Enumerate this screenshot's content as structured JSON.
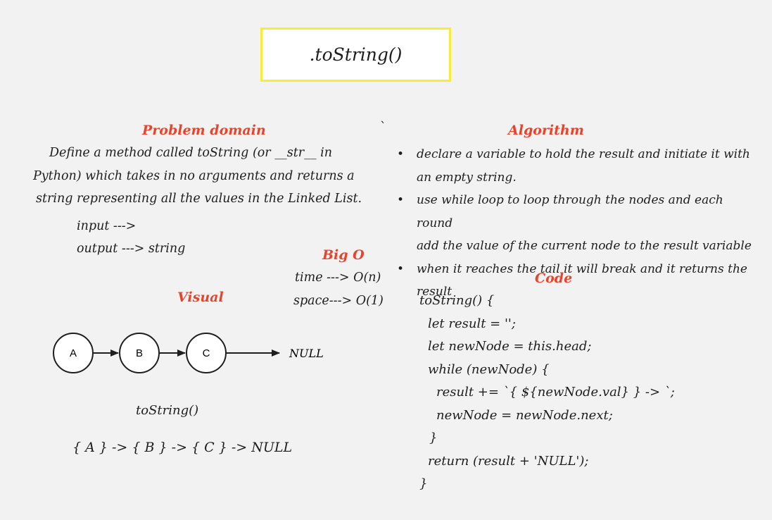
{
  "title": ".toString()",
  "tick_mark": "`",
  "problem_domain": {
    "heading": "Problem domain",
    "lines": [
      "Define a method called toString (or __str__ in",
      "Python) which takes in no arguments and returns a",
      "string representing all the values in the Linked List."
    ],
    "input_line": "input --->",
    "output_line": "output ---> string"
  },
  "big_o": {
    "heading": "Big O",
    "time": "time ---> O(n)",
    "space": "space---> O(1)"
  },
  "visual": {
    "heading": "Visual",
    "nodes": [
      "A",
      "B",
      "C"
    ],
    "null_label": "NULL",
    "method_label": "toString()",
    "result": "{ A } -> { B } -> { C } -> NULL"
  },
  "algorithm": {
    "heading": "Algorithm",
    "steps": [
      [
        "declare a variable to hold the result and initiate it with",
        "an empty string."
      ],
      [
        "use while loop to loop through the nodes and each round",
        "add the value of the current node to the result variable"
      ],
      [
        "when it reaches the tail it will break and it returns the",
        "result"
      ]
    ]
  },
  "code": {
    "heading": "Code",
    "lines": [
      "toString() {",
      "let result = '';",
      "let newNode = this.head;",
      "while (newNode) {",
      "result += `{ ${newNode.val} } -> `;",
      "newNode = newNode.next;",
      "}",
      "return (result + 'NULL');",
      "}"
    ]
  },
  "colors": {
    "background": "#f2f2f2",
    "heading": "#e8442c",
    "title_border": "#f7ec3a",
    "ink": "#1e1e1e"
  }
}
